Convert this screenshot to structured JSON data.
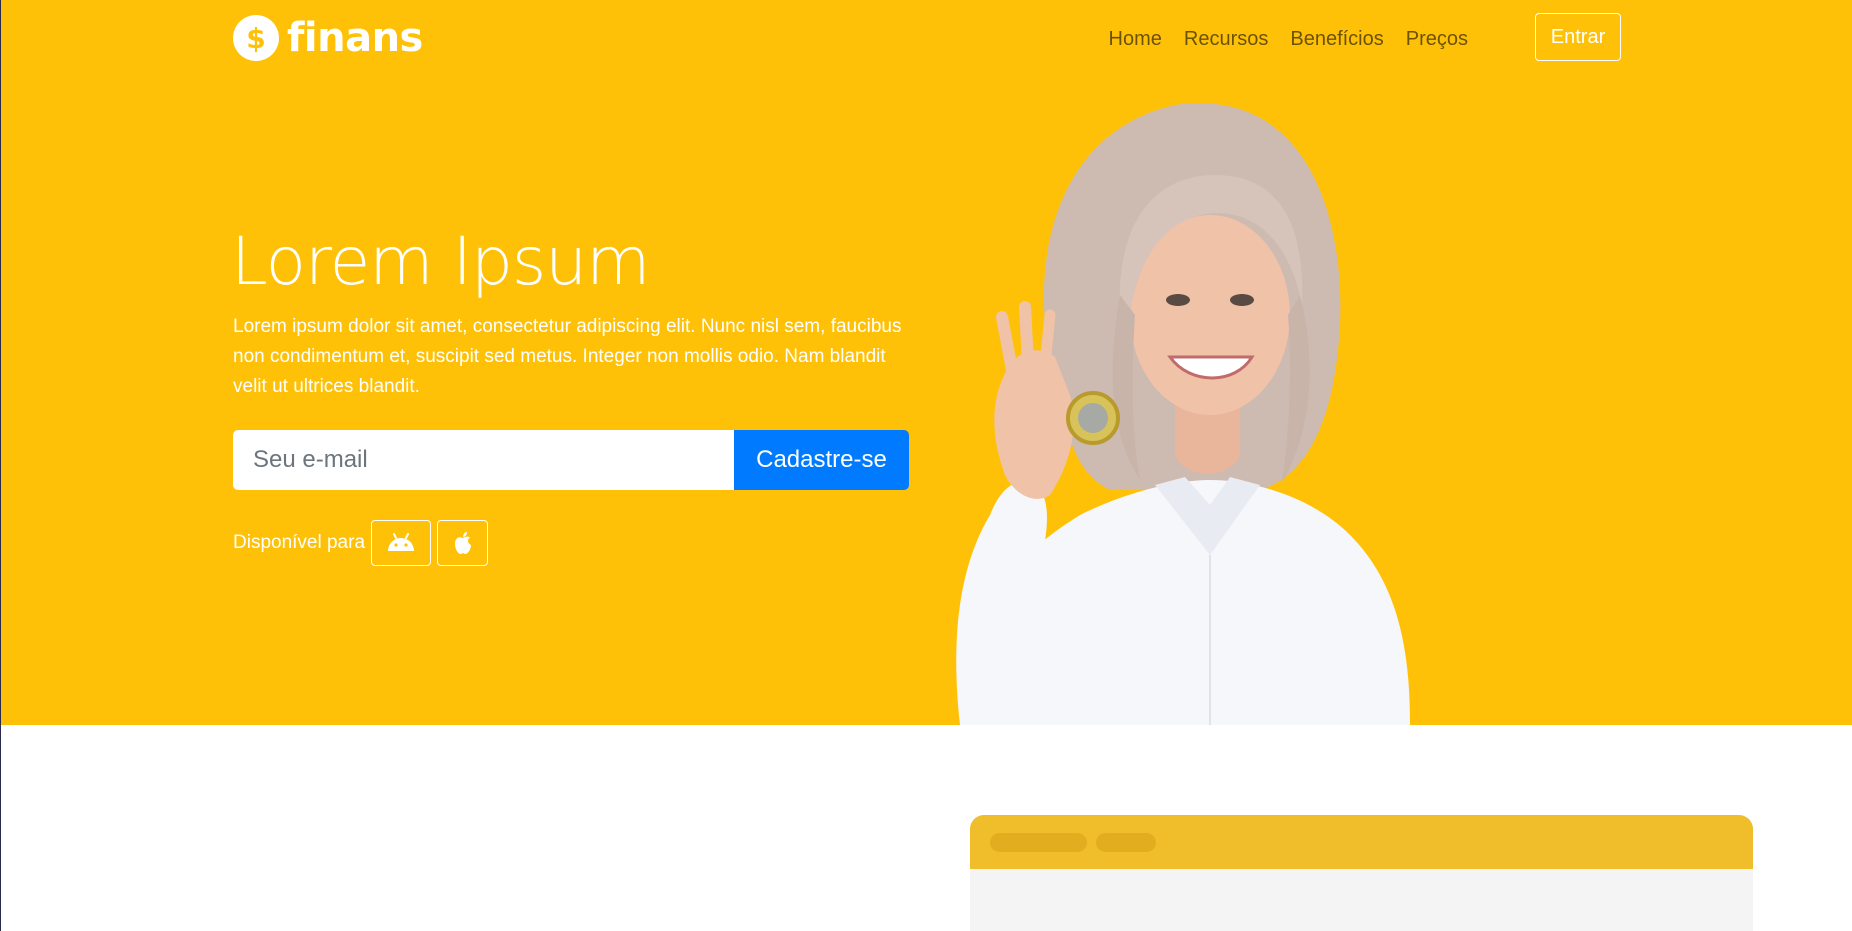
{
  "brand": {
    "name": "finans",
    "icon": "dollar-circle-icon",
    "color": "#ffc107"
  },
  "nav": {
    "items": [
      "Home",
      "Recursos",
      "Benefícios",
      "Preços"
    ],
    "login_label": "Entrar"
  },
  "hero": {
    "title": "Lorem Ipsum",
    "description": "Lorem ipsum dolor sit amet, consectetur adipiscing elit. Nunc nisl sem, faucibus non condimentum et, suscipit sed metus. Integer non mollis odio. Nam blandit velit ut ultrices blandit.",
    "email_placeholder": "Seu e-mail",
    "signup_label": "Cadastre-se",
    "available_label": "Disponível para",
    "stores": [
      "android-icon",
      "apple-icon"
    ]
  },
  "colors": {
    "hero_bg": "#ffc107",
    "primary": "#007bff",
    "preview_header": "#f0be2b"
  }
}
